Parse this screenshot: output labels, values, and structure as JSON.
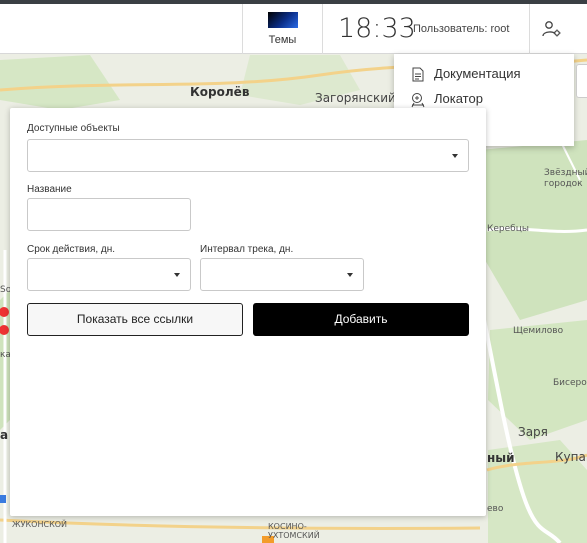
{
  "header": {
    "themes_label": "Темы",
    "clock": "18:33",
    "user_text": "Пользователь: root"
  },
  "menu": {
    "items": [
      {
        "label": "Документация",
        "icon": "document-icon"
      },
      {
        "label": "Локатор",
        "icon": "locator-icon"
      }
    ]
  },
  "form": {
    "available_objects_label": "Доступные объекты",
    "available_objects_value": "",
    "name_label": "Название",
    "name_value": "",
    "validity_label": "Срок действия, дн.",
    "validity_value": "",
    "track_interval_label": "Интервал трека, дн.",
    "track_interval_value": "",
    "show_all_links_label": "Показать все ссылки",
    "add_label": "Добавить"
  },
  "map": {
    "labels": [
      "Королёв",
      "Загорянский",
      "Звёздный городок",
      "Щемилово",
      "Бисеро",
      "Заря",
      "Купав",
      "Керебцы",
      "ный",
      "ево",
      "ЖУКОНСКОЙ",
      "КОСИНО-УХТОМСКИЙ",
      "ка",
      "Sol",
      "а"
    ]
  },
  "colors": {
    "topstrip": "#3a3f44",
    "primary_button": "#000000",
    "map_green": "#cfe3bd",
    "map_base": "#eceee4"
  }
}
